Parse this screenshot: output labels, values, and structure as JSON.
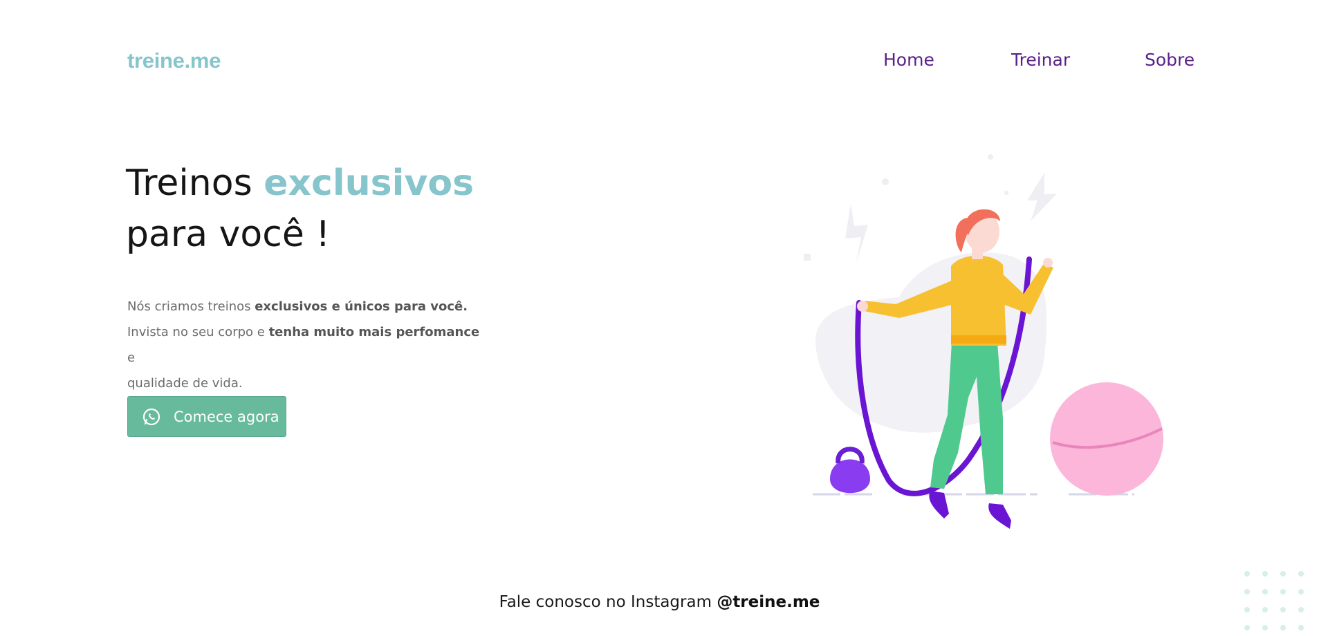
{
  "header": {
    "logo_text": "treine.me",
    "nav": [
      {
        "label": "Home"
      },
      {
        "label": "Treinar"
      },
      {
        "label": "Sobre"
      }
    ]
  },
  "hero": {
    "title_part1": "Treinos ",
    "title_accent": "exclusivos",
    "title_part2": "para você !",
    "desc": {
      "line1_plain": "Nós criamos treinos ",
      "line1_bold": "exclusivos e únicos para você.",
      "line2_plain": "Invista no seu corpo e ",
      "line2_bold": "tenha muito mais perfomance",
      "line2_end": " e",
      "line3_plain": "qualidade de vida."
    },
    "cta_label": "Comece agora"
  },
  "illustration": {
    "description_icon": "jump-rope-woman-illustration-icon"
  },
  "footer": {
    "text_plain": "Fale conosco no Instagram ",
    "handle": "@treine.me"
  },
  "colors": {
    "accent": "#85c5cb",
    "nav": "#5a2189",
    "cta": "#67ba9c"
  }
}
